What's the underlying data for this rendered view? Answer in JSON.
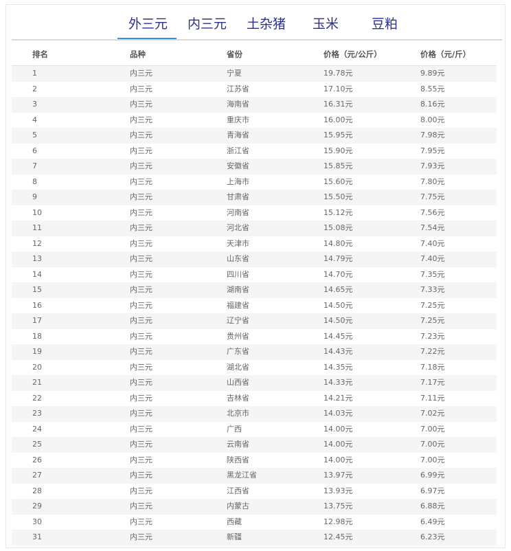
{
  "tabs": [
    {
      "label": "外三元",
      "active": true
    },
    {
      "label": "内三元",
      "active": false
    },
    {
      "label": "土杂猪",
      "active": false
    },
    {
      "label": "玉米",
      "active": false
    },
    {
      "label": "豆粕",
      "active": false
    }
  ],
  "table": {
    "headers": [
      "排名",
      "品种",
      "省份",
      "价格（元/公斤）",
      "价格（元/斤）"
    ],
    "rows": [
      [
        "1",
        "内三元",
        "宁夏",
        "19.78元",
        "9.89元"
      ],
      [
        "2",
        "内三元",
        "江苏省",
        "17.10元",
        "8.55元"
      ],
      [
        "3",
        "内三元",
        "海南省",
        "16.31元",
        "8.16元"
      ],
      [
        "4",
        "内三元",
        "重庆市",
        "16.00元",
        "8.00元"
      ],
      [
        "5",
        "内三元",
        "青海省",
        "15.95元",
        "7.98元"
      ],
      [
        "6",
        "内三元",
        "浙江省",
        "15.90元",
        "7.95元"
      ],
      [
        "7",
        "内三元",
        "安徽省",
        "15.85元",
        "7.93元"
      ],
      [
        "8",
        "内三元",
        "上海市",
        "15.60元",
        "7.80元"
      ],
      [
        "9",
        "内三元",
        "甘肃省",
        "15.50元",
        "7.75元"
      ],
      [
        "10",
        "内三元",
        "河南省",
        "15.12元",
        "7.56元"
      ],
      [
        "11",
        "内三元",
        "河北省",
        "15.08元",
        "7.54元"
      ],
      [
        "12",
        "内三元",
        "天津市",
        "14.80元",
        "7.40元"
      ],
      [
        "13",
        "内三元",
        "山东省",
        "14.79元",
        "7.40元"
      ],
      [
        "14",
        "内三元",
        "四川省",
        "14.70元",
        "7.35元"
      ],
      [
        "15",
        "内三元",
        "湖南省",
        "14.65元",
        "7.33元"
      ],
      [
        "16",
        "内三元",
        "福建省",
        "14.50元",
        "7.25元"
      ],
      [
        "17",
        "内三元",
        "辽宁省",
        "14.50元",
        "7.25元"
      ],
      [
        "18",
        "内三元",
        "贵州省",
        "14.45元",
        "7.23元"
      ],
      [
        "19",
        "内三元",
        "广东省",
        "14.43元",
        "7.22元"
      ],
      [
        "20",
        "内三元",
        "湖北省",
        "14.35元",
        "7.18元"
      ],
      [
        "21",
        "内三元",
        "山西省",
        "14.33元",
        "7.17元"
      ],
      [
        "22",
        "内三元",
        "吉林省",
        "14.21元",
        "7.11元"
      ],
      [
        "23",
        "内三元",
        "北京市",
        "14.03元",
        "7.02元"
      ],
      [
        "24",
        "内三元",
        "广西",
        "14.00元",
        "7.00元"
      ],
      [
        "25",
        "内三元",
        "云南省",
        "14.00元",
        "7.00元"
      ],
      [
        "26",
        "内三元",
        "陕西省",
        "14.00元",
        "7.00元"
      ],
      [
        "27",
        "内三元",
        "黑龙江省",
        "13.97元",
        "6.99元"
      ],
      [
        "28",
        "内三元",
        "江西省",
        "13.93元",
        "6.97元"
      ],
      [
        "29",
        "内三元",
        "内蒙古",
        "13.75元",
        "6.88元"
      ],
      [
        "30",
        "内三元",
        "西藏",
        "12.98元",
        "6.49元"
      ],
      [
        "31",
        "内三元",
        "新疆",
        "12.45元",
        "6.23元"
      ]
    ]
  },
  "colors": {
    "tab_text": "#2b2f8e",
    "tab_active_underline": "#3a8ee6",
    "row_stripe": "#f5f5f5"
  }
}
